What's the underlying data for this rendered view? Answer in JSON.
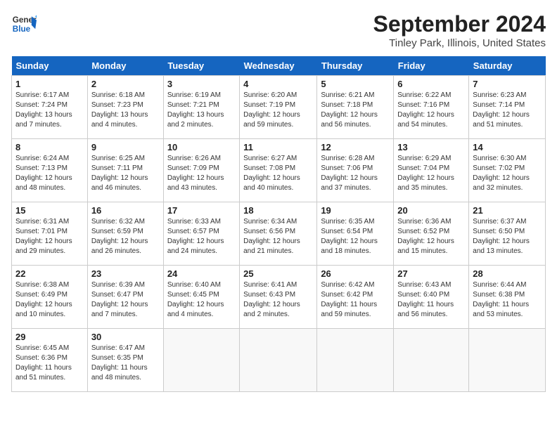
{
  "header": {
    "logo_line1": "General",
    "logo_line2": "Blue",
    "title": "September 2024",
    "subtitle": "Tinley Park, Illinois, United States"
  },
  "weekdays": [
    "Sunday",
    "Monday",
    "Tuesday",
    "Wednesday",
    "Thursday",
    "Friday",
    "Saturday"
  ],
  "weeks": [
    [
      {
        "day": "1",
        "info": "Sunrise: 6:17 AM\nSunset: 7:24 PM\nDaylight: 13 hours\nand 7 minutes."
      },
      {
        "day": "2",
        "info": "Sunrise: 6:18 AM\nSunset: 7:23 PM\nDaylight: 13 hours\nand 4 minutes."
      },
      {
        "day": "3",
        "info": "Sunrise: 6:19 AM\nSunset: 7:21 PM\nDaylight: 13 hours\nand 2 minutes."
      },
      {
        "day": "4",
        "info": "Sunrise: 6:20 AM\nSunset: 7:19 PM\nDaylight: 12 hours\nand 59 minutes."
      },
      {
        "day": "5",
        "info": "Sunrise: 6:21 AM\nSunset: 7:18 PM\nDaylight: 12 hours\nand 56 minutes."
      },
      {
        "day": "6",
        "info": "Sunrise: 6:22 AM\nSunset: 7:16 PM\nDaylight: 12 hours\nand 54 minutes."
      },
      {
        "day": "7",
        "info": "Sunrise: 6:23 AM\nSunset: 7:14 PM\nDaylight: 12 hours\nand 51 minutes."
      }
    ],
    [
      {
        "day": "8",
        "info": "Sunrise: 6:24 AM\nSunset: 7:13 PM\nDaylight: 12 hours\nand 48 minutes."
      },
      {
        "day": "9",
        "info": "Sunrise: 6:25 AM\nSunset: 7:11 PM\nDaylight: 12 hours\nand 46 minutes."
      },
      {
        "day": "10",
        "info": "Sunrise: 6:26 AM\nSunset: 7:09 PM\nDaylight: 12 hours\nand 43 minutes."
      },
      {
        "day": "11",
        "info": "Sunrise: 6:27 AM\nSunset: 7:08 PM\nDaylight: 12 hours\nand 40 minutes."
      },
      {
        "day": "12",
        "info": "Sunrise: 6:28 AM\nSunset: 7:06 PM\nDaylight: 12 hours\nand 37 minutes."
      },
      {
        "day": "13",
        "info": "Sunrise: 6:29 AM\nSunset: 7:04 PM\nDaylight: 12 hours\nand 35 minutes."
      },
      {
        "day": "14",
        "info": "Sunrise: 6:30 AM\nSunset: 7:02 PM\nDaylight: 12 hours\nand 32 minutes."
      }
    ],
    [
      {
        "day": "15",
        "info": "Sunrise: 6:31 AM\nSunset: 7:01 PM\nDaylight: 12 hours\nand 29 minutes."
      },
      {
        "day": "16",
        "info": "Sunrise: 6:32 AM\nSunset: 6:59 PM\nDaylight: 12 hours\nand 26 minutes."
      },
      {
        "day": "17",
        "info": "Sunrise: 6:33 AM\nSunset: 6:57 PM\nDaylight: 12 hours\nand 24 minutes."
      },
      {
        "day": "18",
        "info": "Sunrise: 6:34 AM\nSunset: 6:56 PM\nDaylight: 12 hours\nand 21 minutes."
      },
      {
        "day": "19",
        "info": "Sunrise: 6:35 AM\nSunset: 6:54 PM\nDaylight: 12 hours\nand 18 minutes."
      },
      {
        "day": "20",
        "info": "Sunrise: 6:36 AM\nSunset: 6:52 PM\nDaylight: 12 hours\nand 15 minutes."
      },
      {
        "day": "21",
        "info": "Sunrise: 6:37 AM\nSunset: 6:50 PM\nDaylight: 12 hours\nand 13 minutes."
      }
    ],
    [
      {
        "day": "22",
        "info": "Sunrise: 6:38 AM\nSunset: 6:49 PM\nDaylight: 12 hours\nand 10 minutes."
      },
      {
        "day": "23",
        "info": "Sunrise: 6:39 AM\nSunset: 6:47 PM\nDaylight: 12 hours\nand 7 minutes."
      },
      {
        "day": "24",
        "info": "Sunrise: 6:40 AM\nSunset: 6:45 PM\nDaylight: 12 hours\nand 4 minutes."
      },
      {
        "day": "25",
        "info": "Sunrise: 6:41 AM\nSunset: 6:43 PM\nDaylight: 12 hours\nand 2 minutes."
      },
      {
        "day": "26",
        "info": "Sunrise: 6:42 AM\nSunset: 6:42 PM\nDaylight: 11 hours\nand 59 minutes."
      },
      {
        "day": "27",
        "info": "Sunrise: 6:43 AM\nSunset: 6:40 PM\nDaylight: 11 hours\nand 56 minutes."
      },
      {
        "day": "28",
        "info": "Sunrise: 6:44 AM\nSunset: 6:38 PM\nDaylight: 11 hours\nand 53 minutes."
      }
    ],
    [
      {
        "day": "29",
        "info": "Sunrise: 6:45 AM\nSunset: 6:36 PM\nDaylight: 11 hours\nand 51 minutes."
      },
      {
        "day": "30",
        "info": "Sunrise: 6:47 AM\nSunset: 6:35 PM\nDaylight: 11 hours\nand 48 minutes."
      },
      {
        "day": "",
        "info": ""
      },
      {
        "day": "",
        "info": ""
      },
      {
        "day": "",
        "info": ""
      },
      {
        "day": "",
        "info": ""
      },
      {
        "day": "",
        "info": ""
      }
    ]
  ]
}
